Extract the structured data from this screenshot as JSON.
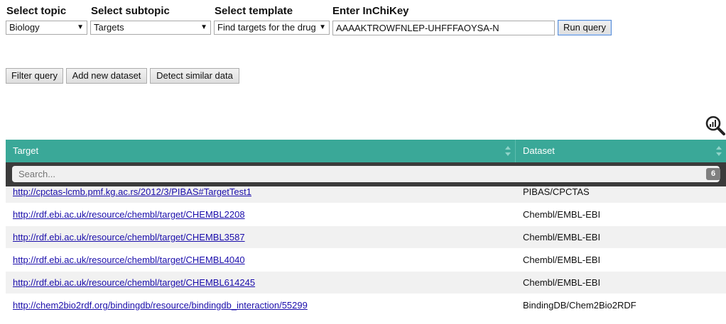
{
  "controls": {
    "topic": {
      "label": "Select topic",
      "value": "Biology"
    },
    "subtopic": {
      "label": "Select subtopic",
      "value": "Targets"
    },
    "template": {
      "label": "Select template",
      "value": "Find targets for the drug"
    },
    "inchikey": {
      "label": "Enter InChiKey",
      "value": "AAAAKTROWFNLEP-UHFFFAOYSA-N"
    },
    "run_label": "Run query"
  },
  "actions": {
    "filter_label": "Filter query",
    "add_label": "Add new dataset",
    "detect_label": "Detect similar data"
  },
  "table": {
    "headers": {
      "target": "Target",
      "dataset": "Dataset"
    },
    "search_placeholder": "Search...",
    "count": "6",
    "rows": [
      {
        "target": "http://cpctas-lcmb.pmf.kg.ac.rs/2012/3/PIBAS#TargetTest1",
        "dataset": "PIBAS/CPCTAS"
      },
      {
        "target": "http://rdf.ebi.ac.uk/resource/chembl/target/CHEMBL2208",
        "dataset": "Chembl/EMBL-EBI"
      },
      {
        "target": "http://rdf.ebi.ac.uk/resource/chembl/target/CHEMBL3587",
        "dataset": "Chembl/EMBL-EBI"
      },
      {
        "target": "http://rdf.ebi.ac.uk/resource/chembl/target/CHEMBL4040",
        "dataset": "Chembl/EMBL-EBI"
      },
      {
        "target": "http://rdf.ebi.ac.uk/resource/chembl/target/CHEMBL614245",
        "dataset": "Chembl/EMBL-EBI"
      },
      {
        "target": "http://chem2bio2rdf.org/bindingdb/resource/bindingdb_interaction/55299",
        "dataset": "BindingDB/Chem2Bio2RDF"
      }
    ]
  },
  "colors": {
    "header_bg": "#3aa898",
    "search_bar_bg": "#3b3b3b",
    "link": "#1a0dab"
  },
  "icons": {
    "zoom": "zoom-chart-icon",
    "sort": "sort-icon",
    "dropdown": "chevron-down-icon"
  }
}
